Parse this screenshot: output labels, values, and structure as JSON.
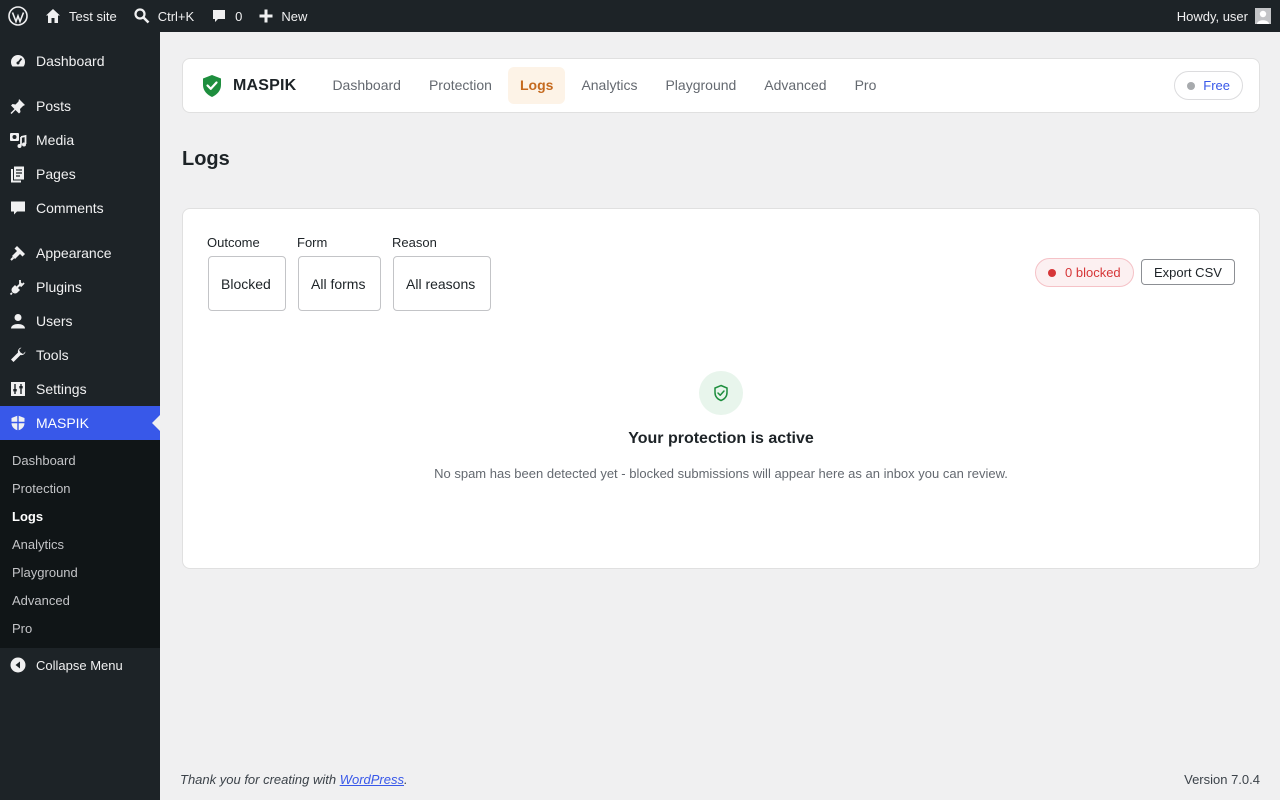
{
  "adminbar": {
    "site_name": "Test site",
    "search_shortcut": "Ctrl+K",
    "comments_count": "0",
    "new_label": "New",
    "greeting": "Howdy, user"
  },
  "sidebar": {
    "items": [
      {
        "label": "Dashboard",
        "icon": "dashboard-icon"
      },
      {
        "label": "Posts",
        "icon": "pin-icon"
      },
      {
        "label": "Media",
        "icon": "media-icon"
      },
      {
        "label": "Pages",
        "icon": "pages-icon"
      },
      {
        "label": "Comments",
        "icon": "comment-icon"
      },
      {
        "label": "Appearance",
        "icon": "brush-icon"
      },
      {
        "label": "Plugins",
        "icon": "plug-icon"
      },
      {
        "label": "Users",
        "icon": "user-icon"
      },
      {
        "label": "Tools",
        "icon": "wrench-icon"
      },
      {
        "label": "Settings",
        "icon": "sliders-icon"
      },
      {
        "label": "MASPIK",
        "icon": "shield-icon"
      }
    ],
    "submenu": [
      "Dashboard",
      "Protection",
      "Logs",
      "Analytics",
      "Playground",
      "Advanced",
      "Pro"
    ],
    "collapse_label": "Collapse Menu"
  },
  "plugin": {
    "brand": "MASPIK",
    "tabs": [
      "Dashboard",
      "Protection",
      "Logs",
      "Analytics",
      "Playground",
      "Advanced",
      "Pro"
    ],
    "active_tab": "Logs",
    "plan": "Free"
  },
  "page": {
    "title": "Logs"
  },
  "filters": {
    "outcome_label": "Outcome",
    "outcome_value": "Blocked",
    "form_label": "Form",
    "form_value": "All forms",
    "reason_label": "Reason",
    "reason_value": "All reasons"
  },
  "summary": {
    "blocked": "0 blocked",
    "export_label": "Export CSV"
  },
  "empty_state": {
    "title": "Your protection is active",
    "description": "No spam has been detected yet - blocked submissions will appear here as an inbox you can review."
  },
  "footer": {
    "thanks_prefix": "Thank you for creating with ",
    "thanks_link": "WordPress",
    "thanks_suffix": ".",
    "version": "Version 7.0.4"
  },
  "colors": {
    "accent": "#3858e9",
    "active_tab": "#c56a1f",
    "danger": "#d63638",
    "success": "#1e8e3e"
  }
}
